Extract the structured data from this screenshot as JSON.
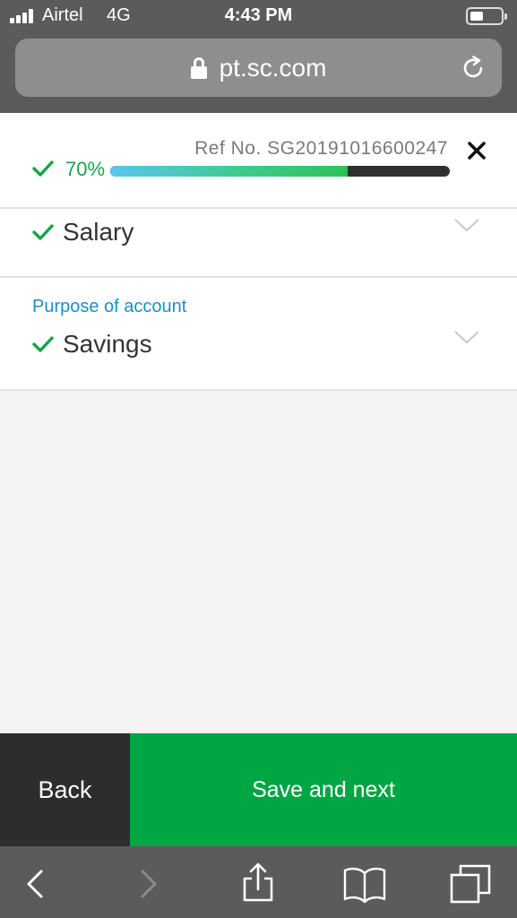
{
  "status_bar": {
    "carrier": "Airtel",
    "network": "4G",
    "time": "4:43 PM",
    "battery_level": 0.4
  },
  "browser": {
    "url": "pt.sc.com"
  },
  "progress": {
    "ref_label": "Ref No. SG20191016600247",
    "percent_label": "70%",
    "fraction": 0.7
  },
  "fields": {
    "income_source": {
      "value": "Salary"
    },
    "purpose": {
      "label": "Purpose of account",
      "value": "Savings"
    }
  },
  "actions": {
    "back_label": "Back",
    "next_label": "Save and next"
  },
  "toolbar": {
    "icons": [
      "back-arrow-icon",
      "forward-arrow-icon",
      "share-icon",
      "bookmarks-icon",
      "tabs-icon"
    ]
  },
  "colors": {
    "success_green": "#00a544",
    "label_blue": "#1a8fc6",
    "chrome_gray": "#5b5b5b",
    "dark_button": "#2d2c2e"
  }
}
